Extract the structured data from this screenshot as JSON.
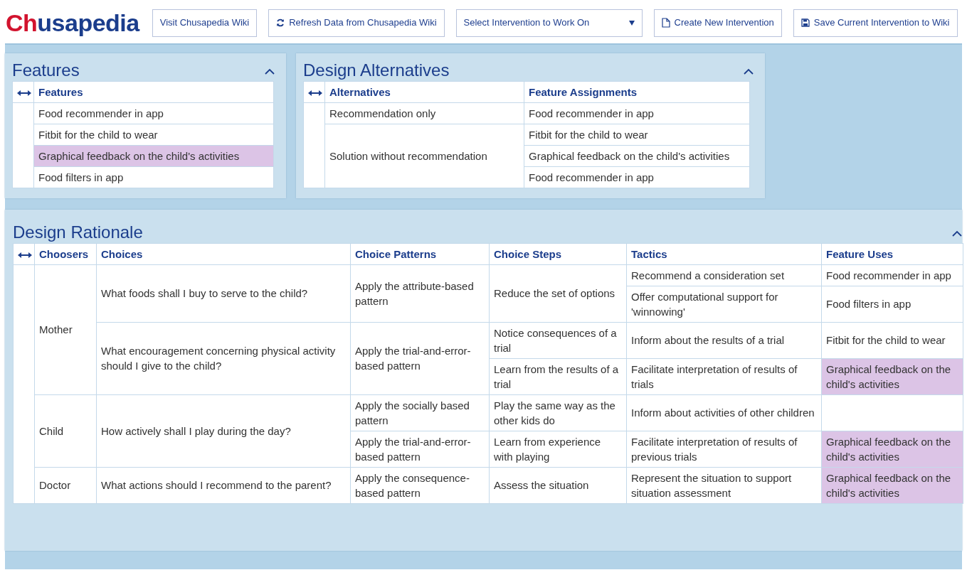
{
  "logo_parts": [
    "Ch",
    "usapedia"
  ],
  "toolbar": [
    {
      "kind": "link",
      "label": "Visit Chusapedia Wiki"
    },
    {
      "kind": "refresh",
      "label": "Refresh Data from Chusapedia Wiki"
    },
    {
      "kind": "select",
      "label": "Select Intervention to Work On"
    },
    {
      "kind": "new",
      "label": "Create New Intervention"
    },
    {
      "kind": "save",
      "label": "Save Current Intervention to Wiki"
    }
  ],
  "features_panel": {
    "title": "Features",
    "column": "Features",
    "items": [
      {
        "text": "Food recommender in app",
        "selected": false
      },
      {
        "text": "Fitbit for the child to wear",
        "selected": false
      },
      {
        "text": "Graphical feedback on the child's activities",
        "selected": true
      },
      {
        "text": "Food filters in app",
        "selected": false
      }
    ]
  },
  "alternatives_panel": {
    "title": "Design Alternatives",
    "columns": [
      "Alternatives",
      "Feature Assignments"
    ],
    "alternatives": [
      {
        "name": "Recommendation only",
        "features": [
          "Food recommender in app"
        ]
      },
      {
        "name": "Solution without recommendation",
        "features": [
          "Fitbit for the child to wear",
          "Graphical feedback on the child's activities",
          "Food recommender in app"
        ]
      }
    ]
  },
  "rationale_panel": {
    "title": "Design Rationale",
    "columns": [
      "Choosers",
      "Choices",
      "Choice Patterns",
      "Choice Steps",
      "Tactics",
      "Feature Uses"
    ],
    "choosers": [
      {
        "text": "Mother",
        "children": [
          {
            "text": "What foods shall I buy to serve to the child?",
            "children": [
              {
                "text": "Apply the attribute-based pattern",
                "children": [
                  {
                    "text": "Reduce the set of options",
                    "children": [
                      {
                        "text": "Recommend a consideration set",
                        "feature_use": {
                          "text": "Food recommender in app",
                          "highlighted": false
                        }
                      },
                      {
                        "text": "Offer computational support for 'winnowing'",
                        "feature_use": {
                          "text": "Food filters in app",
                          "highlighted": false
                        }
                      }
                    ]
                  }
                ]
              }
            ]
          },
          {
            "text": "What encouragement concerning physical activity should I give to the child?",
            "children": [
              {
                "text": "Apply the trial-and-error-based pattern",
                "children": [
                  {
                    "text": "Notice consequences of a trial",
                    "children": [
                      {
                        "text": "Inform about the results of a trial",
                        "feature_use": {
                          "text": "Fitbit for the child to wear",
                          "highlighted": false
                        }
                      }
                    ]
                  },
                  {
                    "text": "Learn from the results of a trial",
                    "children": [
                      {
                        "text": "Facilitate interpretation of results of trials",
                        "feature_use": {
                          "text": "Graphical feedback on the child's activities",
                          "highlighted": true
                        }
                      }
                    ]
                  }
                ]
              }
            ]
          }
        ]
      },
      {
        "text": "Child",
        "children": [
          {
            "text": "How actively shall I play during the day?",
            "children": [
              {
                "text": "Apply the socially based pattern",
                "children": [
                  {
                    "text": "Play the same way as the other kids do",
                    "children": [
                      {
                        "text": "Inform about activities of other children"
                      }
                    ]
                  }
                ]
              },
              {
                "text": "Apply the trial-and-error-based pattern",
                "children": [
                  {
                    "text": "Learn from experience with playing",
                    "children": [
                      {
                        "text": "Facilitate interpretation of results of previous trials",
                        "feature_use": {
                          "text": "Graphical feedback on the child's activities",
                          "highlighted": true
                        }
                      }
                    ]
                  }
                ]
              }
            ]
          }
        ]
      },
      {
        "text": "Doctor",
        "children": [
          {
            "text": "What actions should I recommend to the parent?",
            "children": [
              {
                "text": "Apply the consequence-based pattern",
                "children": [
                  {
                    "text": "Assess the situation",
                    "children": [
                      {
                        "text": "Represent the situation to support situation assessment",
                        "feature_use": {
                          "text": "Graphical feedback on the child's activities",
                          "highlighted": true
                        }
                      }
                    ]
                  }
                ]
              }
            ]
          }
        ]
      }
    ]
  }
}
